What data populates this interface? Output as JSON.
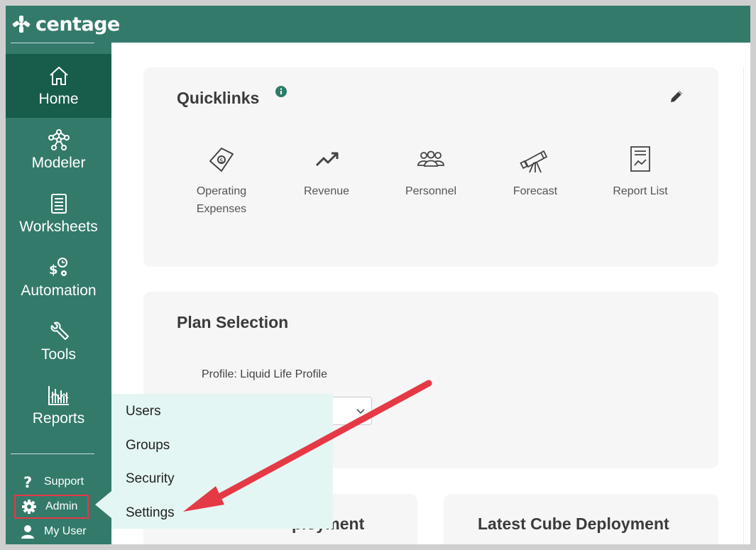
{
  "app": {
    "brand": "centage"
  },
  "sidebar": {
    "items": [
      {
        "label": "Home",
        "icon": "home-icon"
      },
      {
        "label": "Modeler",
        "icon": "modeler-icon"
      },
      {
        "label": "Worksheets",
        "icon": "worksheets-icon"
      },
      {
        "label": "Automation",
        "icon": "automation-icon"
      },
      {
        "label": "Tools",
        "icon": "wrench-icon"
      },
      {
        "label": "Reports",
        "icon": "reports-icon"
      }
    ],
    "bottom": [
      {
        "label": "Support",
        "icon": "question-icon"
      },
      {
        "label": "Admin",
        "icon": "gear-icon"
      },
      {
        "label": "My User",
        "icon": "user-icon"
      }
    ]
  },
  "quicklinks": {
    "title": "Quicklinks",
    "items": [
      {
        "label": "Operating Expenses",
        "icon": "money-icon"
      },
      {
        "label": "Revenue",
        "icon": "trend-up-icon"
      },
      {
        "label": "Personnel",
        "icon": "people-icon"
      },
      {
        "label": "Forecast",
        "icon": "telescope-icon"
      },
      {
        "label": "Report List",
        "icon": "report-list-icon"
      }
    ]
  },
  "plan_selection": {
    "title": "Plan Selection",
    "profile_label": "Profile:",
    "profile_value": "Liquid Life Profile"
  },
  "deployments": {
    "left_title_partial": "ployment",
    "right_title": "Latest Cube Deployment"
  },
  "admin_menu": {
    "items": [
      "Users",
      "Groups",
      "Security",
      "Settings"
    ]
  },
  "colors": {
    "sidebar": "#337a6b",
    "active": "#185c4b",
    "menu_bg": "#e4f6f3",
    "annotation": "#e53945"
  }
}
